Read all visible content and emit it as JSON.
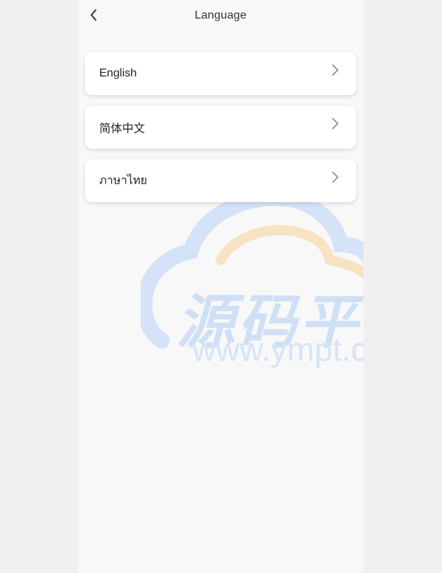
{
  "header": {
    "title": "Language"
  },
  "languages": [
    {
      "label": "English"
    },
    {
      "label": "简体中文"
    },
    {
      "label": "ภาษาไทย"
    }
  ],
  "watermark": {
    "text": "源码平台",
    "url": "www.ympt.cc"
  },
  "icons": {
    "back": "chevron-left-icon",
    "item_arrow": "chevron-right-icon"
  },
  "colors": {
    "page_bg": "#f0f0f0",
    "screen_bg": "#f8f8f8",
    "card_bg": "#ffffff",
    "watermark_blue": "#cfe0f6",
    "watermark_orange": "#f7e3c2"
  }
}
